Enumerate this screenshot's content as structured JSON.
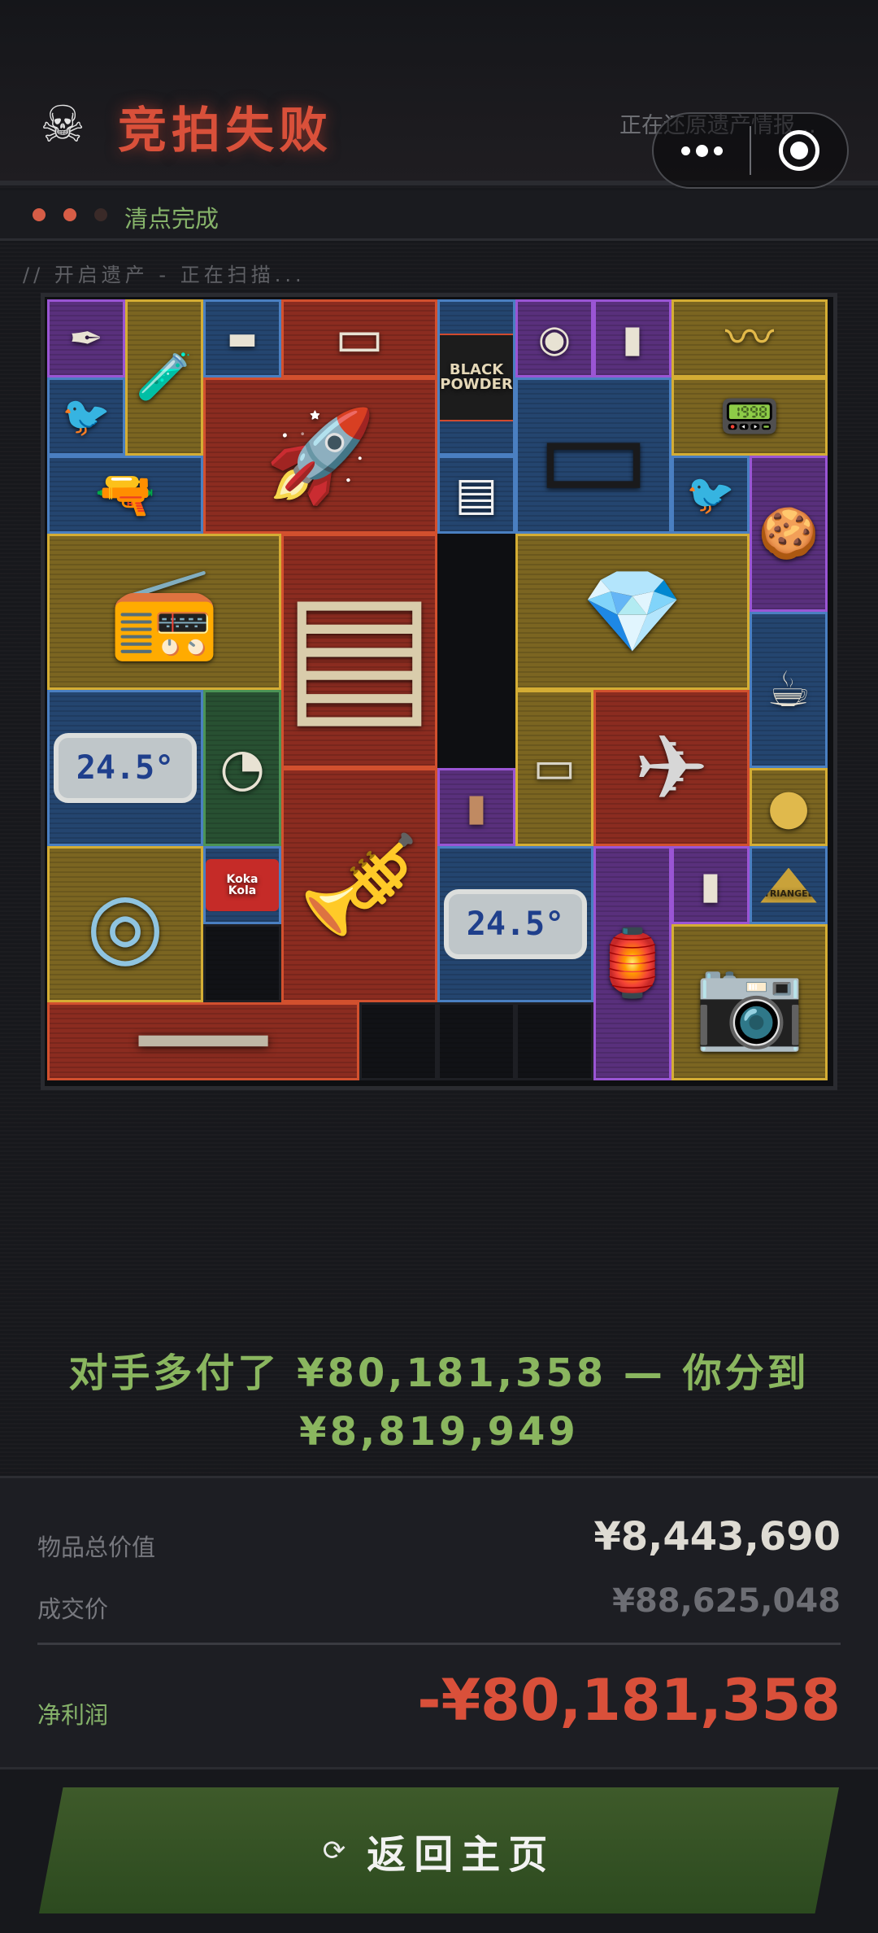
{
  "header": {
    "skull_icon": "☠",
    "title": "竞拍失败",
    "restoring_text": "正在还原遗产情报..."
  },
  "status": {
    "dots": [
      "#d65d46",
      "#d65d46",
      "#3a2a28"
    ],
    "text": "清点完成"
  },
  "scan_label": "//  开启遗产 - 正在扫描...",
  "grid_items": [
    {
      "name": "pen",
      "glyph": "✒"
    },
    {
      "name": "test-tube",
      "glyph": "🧪"
    },
    {
      "name": "usb-drive",
      "glyph": "▬"
    },
    {
      "name": "tablet-device",
      "glyph": "▭"
    },
    {
      "name": "black-powder",
      "text": "BLACK POWDER"
    },
    {
      "name": "tin-can",
      "glyph": "◉"
    },
    {
      "name": "memory-card",
      "glyph": "▮"
    },
    {
      "name": "laurel-crown",
      "glyph": "〰"
    },
    {
      "name": "bird-statue",
      "glyph": "🐦"
    },
    {
      "name": "missile",
      "glyph": "🚀"
    },
    {
      "name": "tablet",
      "glyph": "▭"
    },
    {
      "name": "radio-device",
      "glyph": "📟"
    },
    {
      "name": "rifles",
      "glyph": "🔫"
    },
    {
      "name": "cigarettes",
      "glyph": "▤"
    },
    {
      "name": "bird-statue-2",
      "glyph": "🐦"
    },
    {
      "name": "gingerbread",
      "glyph": "🍪"
    },
    {
      "name": "radio-station",
      "glyph": "📻"
    },
    {
      "name": "server-rack",
      "glyph": "▤"
    },
    {
      "name": "jewel-necklace",
      "glyph": "💎"
    },
    {
      "name": "coffee-pot",
      "glyph": "☕"
    },
    {
      "name": "thermometer",
      "lcd": "24.5°"
    },
    {
      "name": "pressure-gauge",
      "glyph": "◔"
    },
    {
      "name": "paper-note",
      "glyph": "▭"
    },
    {
      "name": "drone",
      "glyph": "✈"
    },
    {
      "name": "chip-bag",
      "glyph": "▮"
    },
    {
      "name": "gold-coin",
      "glyph": "●"
    },
    {
      "name": "cable-reel",
      "glyph": "◎"
    },
    {
      "name": "cola-can",
      "text": "Koka Kola"
    },
    {
      "name": "gramophone",
      "glyph": "🎺"
    },
    {
      "name": "thermometer-2",
      "lcd": "24.5°"
    },
    {
      "name": "lantern",
      "glyph": "🏮"
    },
    {
      "name": "memory-card-2",
      "glyph": "▮"
    },
    {
      "name": "triangle-box",
      "text": "TRIANGEL"
    },
    {
      "name": "camera",
      "glyph": "📷"
    },
    {
      "name": "musket",
      "glyph": "━"
    }
  ],
  "message": "对手多付了 ¥80,181,358 — 你分到 ¥8,819,949",
  "summary": {
    "total_label": "物品总价值",
    "total_value": "¥8,443,690",
    "deal_label": "成交价",
    "deal_value": "¥88,625,048",
    "profit_label": "净利润",
    "profit_value": "-¥80,181,358"
  },
  "button": {
    "icon": "⟳",
    "label": "返回主页"
  },
  "colors": {
    "title_red": "#d9503a",
    "accent_green": "#86b36a",
    "loss_red": "#d9503a"
  }
}
